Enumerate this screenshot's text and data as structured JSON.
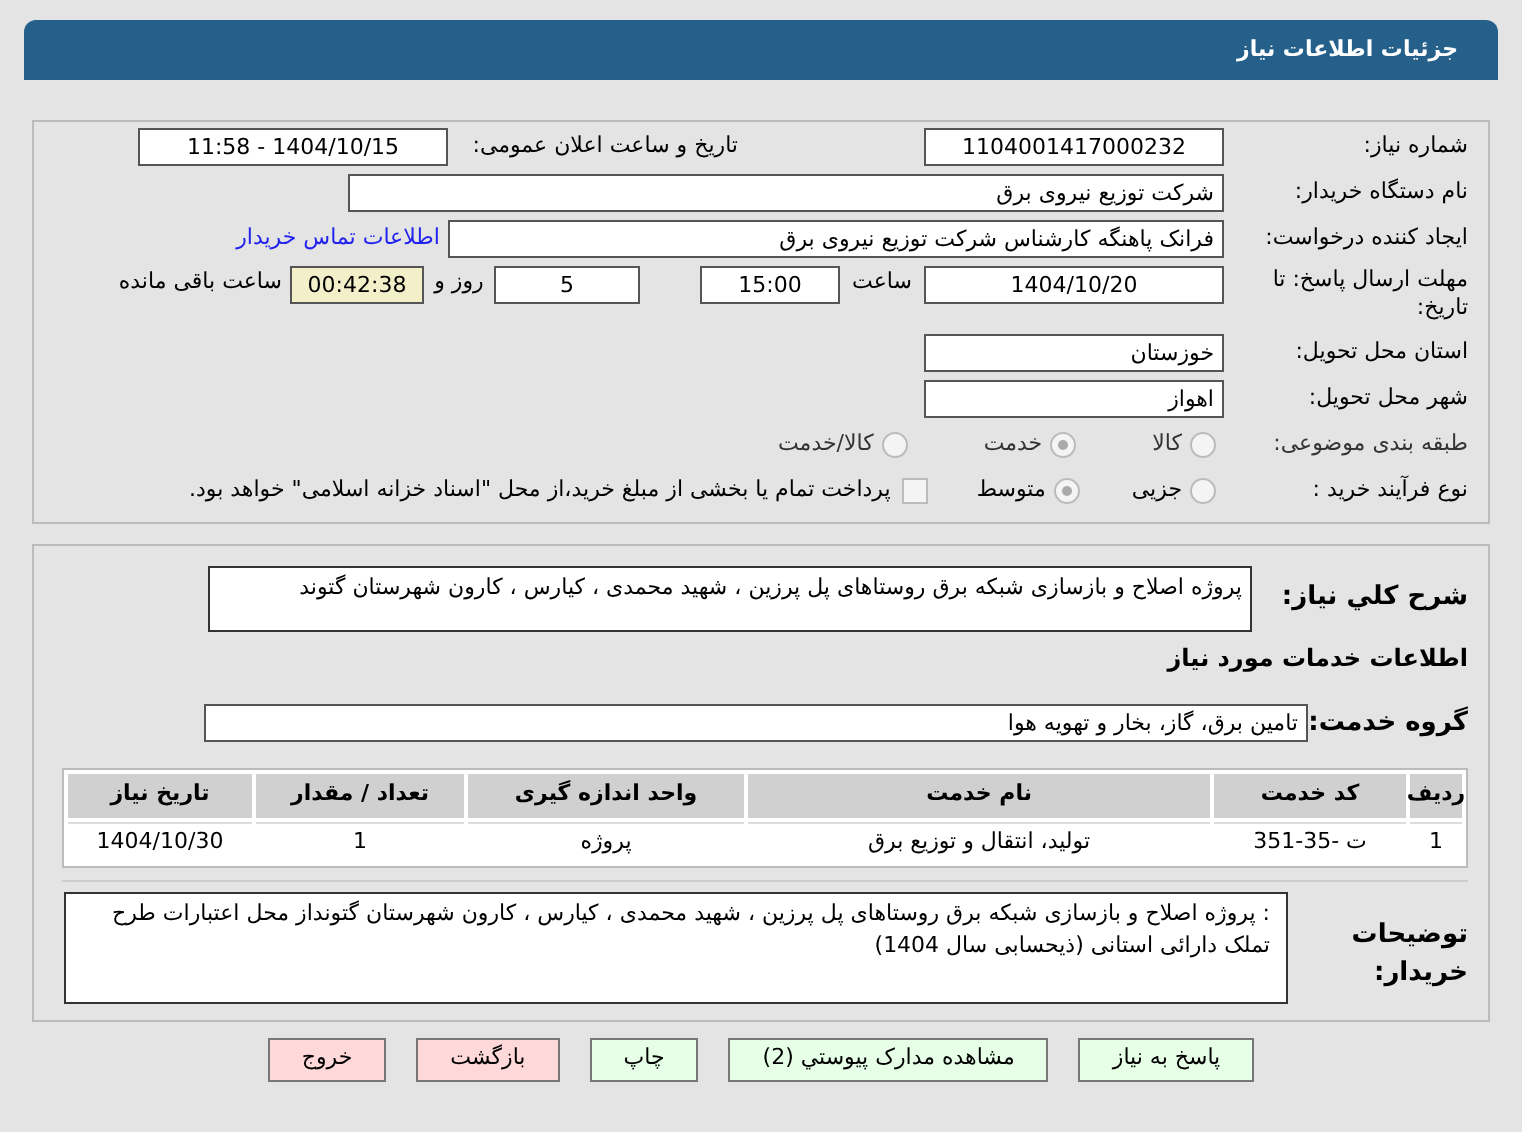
{
  "header": {
    "title": "جزئیات اطلاعات نیاز"
  },
  "need_number": {
    "label": "شماره نیاز:",
    "value": "1104001417000232"
  },
  "announce": {
    "label": "تاریخ و ساعت اعلان عمومی:",
    "value": "1404/10/15 - 11:58"
  },
  "buyer": {
    "label": "نام دستگاه خریدار:",
    "value": "شرکت توزیع نیروی برق"
  },
  "creator": {
    "label": "ایجاد کننده درخواست:",
    "value": "فرانک  پاهنگه کارشناس  شرکت توزیع نیروی برق",
    "link": "اطلاعات تماس خریدار"
  },
  "deadline": {
    "label": "مهلت ارسال پاسخ: تا تاریخ:",
    "date": "1404/10/20",
    "time_label": "ساعت",
    "time": "15:00",
    "days": "5",
    "days_label": "روز و",
    "remaining": "00:42:38",
    "remaining_label": "ساعت باقی مانده"
  },
  "province": {
    "label": "استان محل تحویل:",
    "value": "خوزستان"
  },
  "city": {
    "label": "شهر محل تحویل:",
    "value": "اهواز"
  },
  "category": {
    "label": "طبقه بندی موضوعی:",
    "options": [
      {
        "label": "کالا",
        "selected": false
      },
      {
        "label": "خدمت",
        "selected": true
      },
      {
        "label": "کالا/خدمت",
        "selected": false
      }
    ]
  },
  "purchase_type": {
    "label": "نوع فرآیند خرید :",
    "options": [
      {
        "label": "جزیی",
        "selected": false
      },
      {
        "label": "متوسط",
        "selected": true
      }
    ],
    "payment_check": {
      "label": "پرداخت تمام یا بخشی از مبلغ خرید،از محل \"اسناد خزانه اسلامی\" خواهد بود.",
      "checked": false
    }
  },
  "description": {
    "label": "شرح کلي نياز:",
    "value": "پروژه  اصلاح و بازسازی شبکه برق روستاهای پل پرزین ، شهید محمدی ، کیارس ، کارون شهرستان  گتوند"
  },
  "services_heading": "اطلاعات خدمات مورد نیاز",
  "service_group": {
    "label": "گروه خدمت:",
    "value": "تامین برق، گاز، بخار و تهویه هوا"
  },
  "table": {
    "columns": [
      "ردیف",
      "کد خدمت",
      "نام خدمت",
      "واحد اندازه گیری",
      "تعداد / مقدار",
      "تاریخ نیاز"
    ],
    "rows": [
      [
        "1",
        "ت -35-351",
        "تولید، انتقال و توزیع برق",
        "پروژه",
        "1",
        "1404/10/30"
      ]
    ]
  },
  "buyer_notes": {
    "label": "توضیحات خریدار:",
    "value": ": پروژه  اصلاح و بازسازی شبکه برق روستاهای پل پرزین ، شهید محمدی ، کیارس ، کارون شهرستان  گتونداز محل اعتبارات طرح تملک دارائی استانی (ذیحسابی سال 1404)"
  },
  "buttons": [
    {
      "label": "پاسخ به نیاز",
      "kind": "green"
    },
    {
      "label": "مشاهده مدارک پیوستي (2)",
      "kind": "green"
    },
    {
      "label": "چاپ",
      "kind": "green"
    },
    {
      "label": "بازگشت",
      "kind": "red"
    },
    {
      "label": "خروج",
      "kind": "red"
    }
  ]
}
